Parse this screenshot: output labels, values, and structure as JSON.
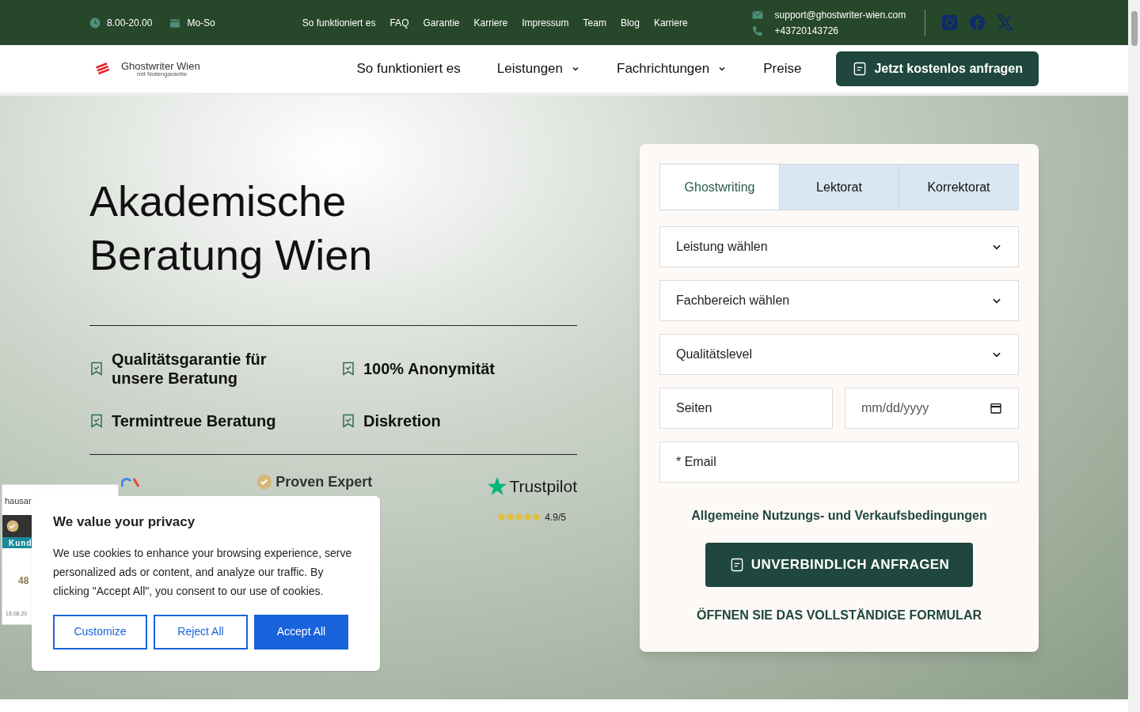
{
  "topbar": {
    "hours": "8.00-20.00",
    "days": "Mo-So",
    "links": [
      "So funktioniert es",
      "FAQ",
      "Garantie",
      "Karriere",
      "Impressum",
      "Team",
      "Blog",
      "Karriere"
    ],
    "email": "support@ghostwriter-wien.com",
    "phone": "+43720143726"
  },
  "nav": {
    "logo_title": "Ghostwriter Wien",
    "logo_subtitle": "mit Notengarantie",
    "items": [
      {
        "label": "So funktioniert es",
        "dropdown": false
      },
      {
        "label": "Leistungen",
        "dropdown": true
      },
      {
        "label": "Fachrichtungen",
        "dropdown": true
      },
      {
        "label": "Preise",
        "dropdown": false
      }
    ],
    "cta": "Jetzt kostenlos anfragen"
  },
  "hero": {
    "title_lines": [
      "Akademische",
      "Beratung Wien"
    ],
    "features": [
      "Qualitätsgarantie für unsere Beratung",
      "100% Anonymität",
      "Termintreue Beratung",
      "Diskretion"
    ],
    "proven_expert": "Proven Expert",
    "trustpilot": {
      "logo": "Trustpilot",
      "stars": 5,
      "rating": "4.9/5"
    }
  },
  "widget": {
    "title": "hausar",
    "band": "Kund",
    "score": "48",
    "date": "18.08.20"
  },
  "form": {
    "tabs": [
      {
        "label": "Ghostwriting",
        "selected": true
      },
      {
        "label": "Lektorat",
        "selected": false
      },
      {
        "label": "Korrektorat",
        "selected": false
      }
    ],
    "selects": [
      "Leistung wählen",
      "Fachbereich wählen",
      "Qualitätslevel"
    ],
    "pages_placeholder": "Seiten",
    "date_placeholder": "mm/dd/yyyy",
    "email_placeholder": "* Email",
    "terms": "Allgemeine Nutzungs- und Verkaufsbedingungen",
    "submit": "UNVERBINDLICH ANFRAGEN",
    "full_form": "ÖFFNEN SIE DAS VOLLSTÄNDIGE FORMULAR"
  },
  "cookie": {
    "title": "We value your privacy",
    "text": "We use cookies to enhance your browsing experience, serve personalized ads or content, and analyze our traffic. By clicking \"Accept All\", you consent to our use of cookies.",
    "buttons": [
      {
        "label": "Customize",
        "kind": "outline"
      },
      {
        "label": "Reject All",
        "kind": "outline"
      },
      {
        "label": "Accept All",
        "kind": "primary"
      }
    ]
  }
}
